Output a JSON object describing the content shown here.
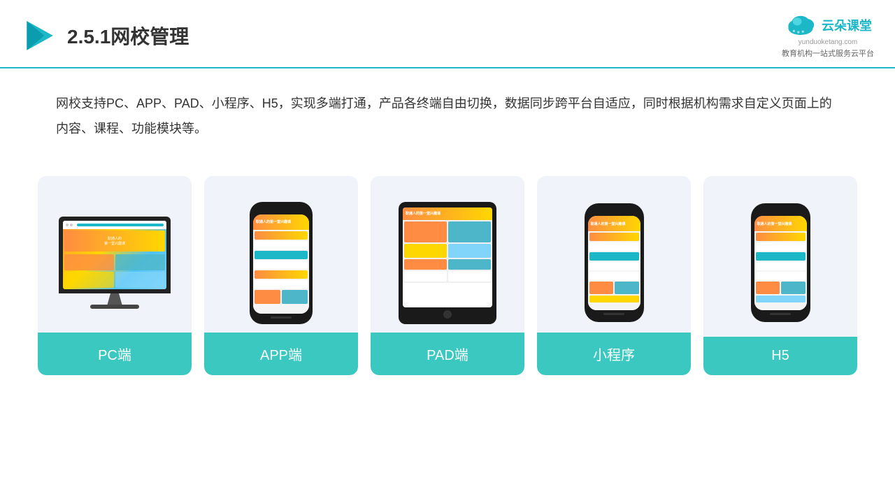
{
  "header": {
    "title": "2.5.1网校管理",
    "brand_name": "云朵课堂",
    "brand_url": "yunduoketang.com",
    "brand_tagline": "教育机构一站式服务云平台"
  },
  "description": {
    "text": "网校支持PC、APP、PAD、小程序、H5，实现多端打通，产品各终端自由切换，数据同步跨平台自适应，同时根据机构需求自定义页面上的内容、课程、功能模块等。"
  },
  "cards": [
    {
      "id": "pc",
      "label": "PC端"
    },
    {
      "id": "app",
      "label": "APP端"
    },
    {
      "id": "pad",
      "label": "PAD端"
    },
    {
      "id": "miniprogram",
      "label": "小程序"
    },
    {
      "id": "h5",
      "label": "H5"
    }
  ]
}
